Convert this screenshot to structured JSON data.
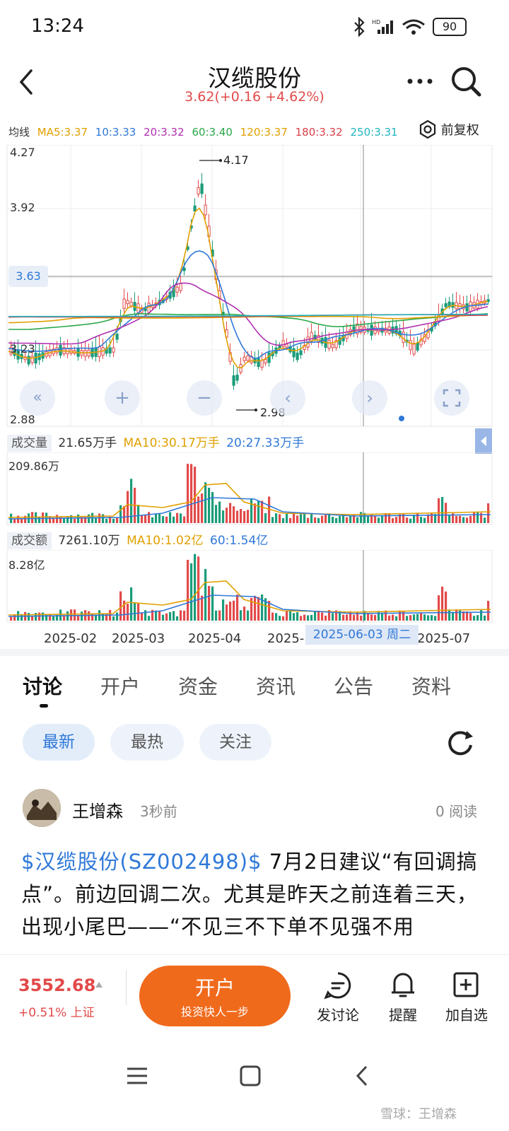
{
  "status": {
    "time": "13:24",
    "battery": "90"
  },
  "header": {
    "title": "汉缆股份",
    "price_line": "3.62(+0.16 +4.62%)"
  },
  "ma_legend": {
    "label": "均线",
    "items": [
      {
        "text": "MA5:3.37",
        "color": "#e0a000"
      },
      {
        "text": "10:3.33",
        "color": "#2f78d8"
      },
      {
        "text": "20:3.32",
        "color": "#b02fb0"
      },
      {
        "text": "60:3.40",
        "color": "#2aa84a"
      },
      {
        "text": "120:3.37",
        "color": "#e0a000"
      },
      {
        "text": "180:3.32",
        "color": "#d8404a"
      },
      {
        "text": "250:3.31",
        "color": "#22b5c0"
      }
    ],
    "adjust_label": "前复权"
  },
  "price_chart": {
    "y_labels": [
      "4.27",
      "3.92",
      "3.23",
      "2.88"
    ],
    "crosshair_price": "3.63",
    "high_mark": "4.17",
    "low_mark": "2.98"
  },
  "volume": {
    "label": "成交量",
    "value": "21.65万手",
    "ma10": "MA10:30.17万手",
    "ma20": "20:27.33万手",
    "max_label": "209.86万"
  },
  "turnover": {
    "label": "成交额",
    "value": "7261.10万",
    "ma10": "MA10:1.02亿",
    "ma60": "60:1.54亿",
    "max_label": "8.28亿"
  },
  "x_axis": [
    "2025-02",
    "2025-03",
    "2025-04",
    "2025-",
    "2025-07"
  ],
  "crosshair_date": "2025-06-03 周二",
  "colors": {
    "up": "#e24a4a",
    "down": "#1a9c7a",
    "accent": "#2f78d8",
    "orange": "#f06a1c"
  },
  "tabs": [
    "讨论",
    "开户",
    "资金",
    "资讯",
    "公告",
    "资料"
  ],
  "filters": [
    "最新",
    "最热",
    "关注"
  ],
  "post": {
    "author": "王增森",
    "time": "3秒前",
    "reads": "0 阅读",
    "stock_link": "$汉缆股份(SZ002498)$",
    "text": " 7月2日建议“有回调搞点”。前边回调二次。尤其是昨天之前连着三天，出现小尾巴——“不见三不下单不见强不用"
  },
  "bottom": {
    "index_value": "3552.68",
    "index_change": "+0.51% 上证",
    "open_title": "开户",
    "open_sub": "投资快人一步",
    "actions": [
      "发讨论",
      "提醒",
      "加自选"
    ]
  },
  "watermark": "雪球：王增森"
}
